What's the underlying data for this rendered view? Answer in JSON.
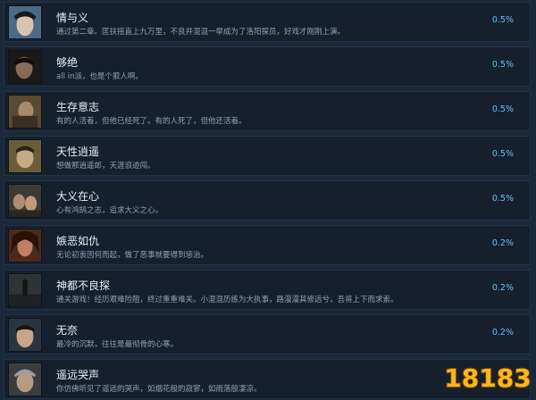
{
  "achievements": [
    {
      "title": "情与义",
      "desc": "通过第二章。匡扶摇直上九万里，不良井混混一举成为了洛阳探员，好戏才刚刚上演。",
      "pct": "0.5%",
      "avatar_icon": "portrait-icon"
    },
    {
      "title": "够绝",
      "desc": "all in派，也是个狠人啊。",
      "pct": "0.5%",
      "avatar_icon": "portrait-icon"
    },
    {
      "title": "生存意志",
      "desc": "有的人活着，但他已经死了。有的人死了，但他还活着。",
      "pct": "0.5%",
      "avatar_icon": "portrait-icon"
    },
    {
      "title": "天性逍遥",
      "desc": "想做那逍遥郎，天涯浪迹闯。",
      "pct": "0.5%",
      "avatar_icon": "portrait-icon"
    },
    {
      "title": "大义在心",
      "desc": "心有鸿鹄之志，追求大义之心。",
      "pct": "0.5%",
      "avatar_icon": "portrait-icon"
    },
    {
      "title": "嫉恶如仇",
      "desc": "无论初衷因何而起，做了恶事就要得到惩治。",
      "pct": "0.2%",
      "avatar_icon": "portrait-icon"
    },
    {
      "title": "神都不良探",
      "desc": "通关游戏！经历艰难险阻，终过重重难关。小混混历练为大执事，路漫漫其修远兮，吾将上下而求索。",
      "pct": "0.2%",
      "avatar_icon": "portrait-icon"
    },
    {
      "title": "无奈",
      "desc": "最冷的沉默，往往是最彻骨的心寒。",
      "pct": "0.2%",
      "avatar_icon": "portrait-icon"
    },
    {
      "title": "遥远哭声",
      "desc": "你仿佛听见了遥远的哭声，如烟花般的寂寥，如雨落般凄凉。",
      "pct": "",
      "avatar_icon": "portrait-icon"
    }
  ],
  "watermark": {
    "text": "18183",
    "colors": {
      "main": "#f5b820",
      "outline": "#7a3d00"
    }
  },
  "colors": {
    "background": "#1b2838",
    "row": "#16202d",
    "percent": "#66c0f4"
  }
}
